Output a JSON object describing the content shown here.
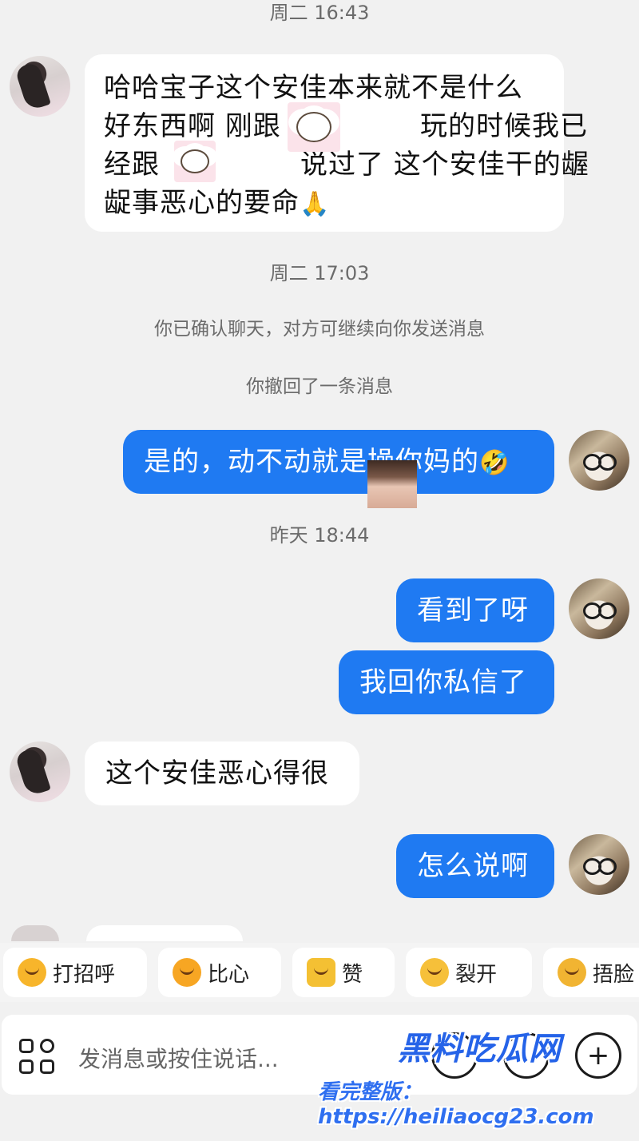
{
  "messages": {
    "ts1": "周二 16:43",
    "msg1_lines": [
      "哈哈宝子这个安佳本来就不是什么",
      "好东西啊 刚跟",
      "玩的时候我已",
      "经跟",
      "说过了 这个安佳干的龌",
      "龊事恶心的要命"
    ],
    "msg1_emoji": "🙏",
    "ts2": "周二 17:03",
    "sys1": "你已确认聊天，对方可继续向你发送消息",
    "sys2": "你撤回了一条消息",
    "msg2": "是的，动不动就是操你妈的",
    "msg2_emoji": "🤣",
    "ts3": "昨天 18:44",
    "msg3": "看到了呀",
    "msg4": "我回你私信了",
    "msg5": "这个安佳恶心得很",
    "msg6": "怎么说啊"
  },
  "quick_replies": [
    {
      "label": "打招呼",
      "icon": "smile-emoji-icon"
    },
    {
      "label": "比心",
      "icon": "heart-hands-emoji-icon"
    },
    {
      "label": "赞",
      "icon": "thumbs-up-emoji-icon"
    },
    {
      "label": "裂开",
      "icon": "crying-emoji-icon"
    },
    {
      "label": "捂脸",
      "icon": "facepalm-emoji-icon"
    }
  ],
  "input": {
    "placeholder": "发消息或按住说话..."
  },
  "watermark": {
    "title": "黑料吃瓜网",
    "url": "看完整版：https://heiliaocg23.com"
  },
  "colors": {
    "background": "#f1f1f1",
    "outgoing_bubble": "#1f7af2",
    "incoming_bubble": "#ffffff"
  }
}
